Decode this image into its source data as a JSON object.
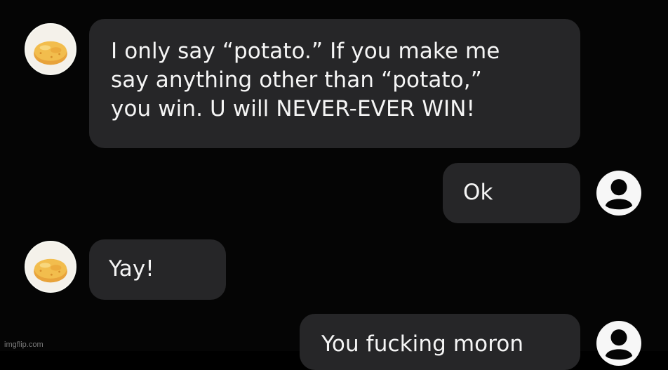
{
  "messages": [
    {
      "sender": "potato",
      "lines": [
        "I only say “potato.” If you make me",
        "say anything other than “potato,”",
        "you win. U will NEVER-EVER WIN!"
      ]
    },
    {
      "sender": "user",
      "text": "Ok"
    },
    {
      "sender": "potato",
      "text": "Yay!"
    },
    {
      "sender": "user",
      "text": "You fucking moron"
    }
  ],
  "watermark": "imgflip.com",
  "colors": {
    "background": "#050505",
    "bubble": "#262628",
    "text": "#f5f5f5",
    "user_icon": "#f7f7f7"
  },
  "icons": {
    "potato_avatar": "potato-avatar-icon",
    "user_avatar": "user-profile-icon"
  }
}
